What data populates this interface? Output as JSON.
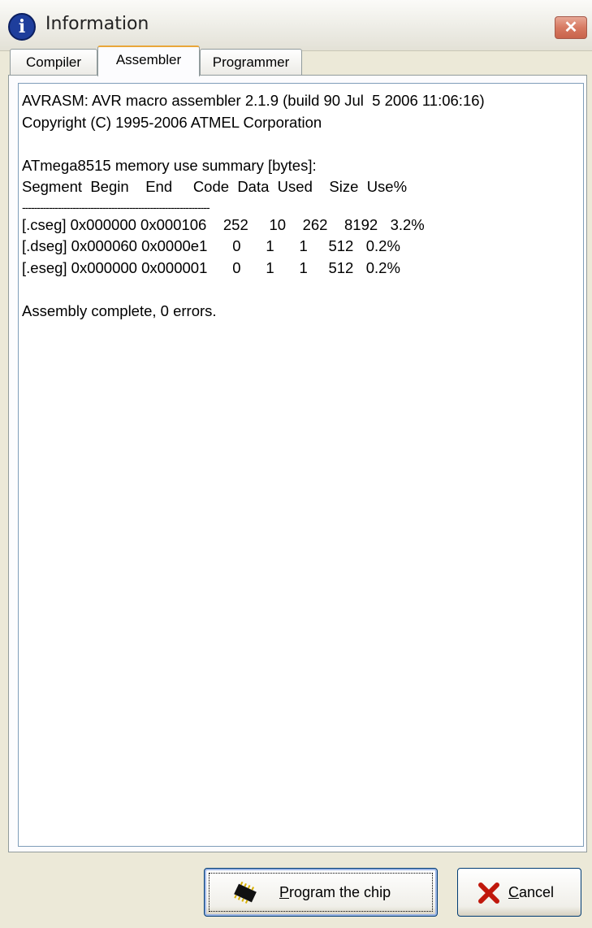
{
  "window": {
    "title": "Information"
  },
  "tabs": [
    {
      "label": "Compiler",
      "active": false
    },
    {
      "label": "Assembler",
      "active": true
    },
    {
      "label": "Programmer",
      "active": false
    }
  ],
  "output": {
    "lines": [
      "AVRASM: AVR macro assembler 2.1.9 (build 90 Jul  5 2006 11:06:16)",
      "Copyright (C) 1995-2006 ATMEL Corporation",
      "",
      "ATmega8515 memory use summary [bytes]:",
      "Segment  Begin    End     Code  Data  Used    Size  Use%",
      "---------------------------------------------------------------",
      "[.cseg] 0x000000 0x000106    252     10    262    8192   3.2%",
      "[.dseg] 0x000060 0x0000e1      0      1      1     512   0.2%",
      "[.eseg] 0x000000 0x000001      0      1      1     512   0.2%",
      "",
      "Assembly complete, 0 errors."
    ]
  },
  "buttons": {
    "program_label": "Program the chip",
    "program_mnemonic": "P",
    "cancel_label": "Cancel",
    "cancel_mnemonic": "C"
  },
  "icons": {
    "title": "info-icon",
    "close": "close-icon",
    "program": "chip-icon",
    "cancel": "red-x-icon"
  },
  "colors": {
    "dialog_bg": "#ece9d8",
    "active_tab_highlight": "#e9a63a",
    "close_button": "#d77a62",
    "cancel_x": "#c0180c"
  }
}
